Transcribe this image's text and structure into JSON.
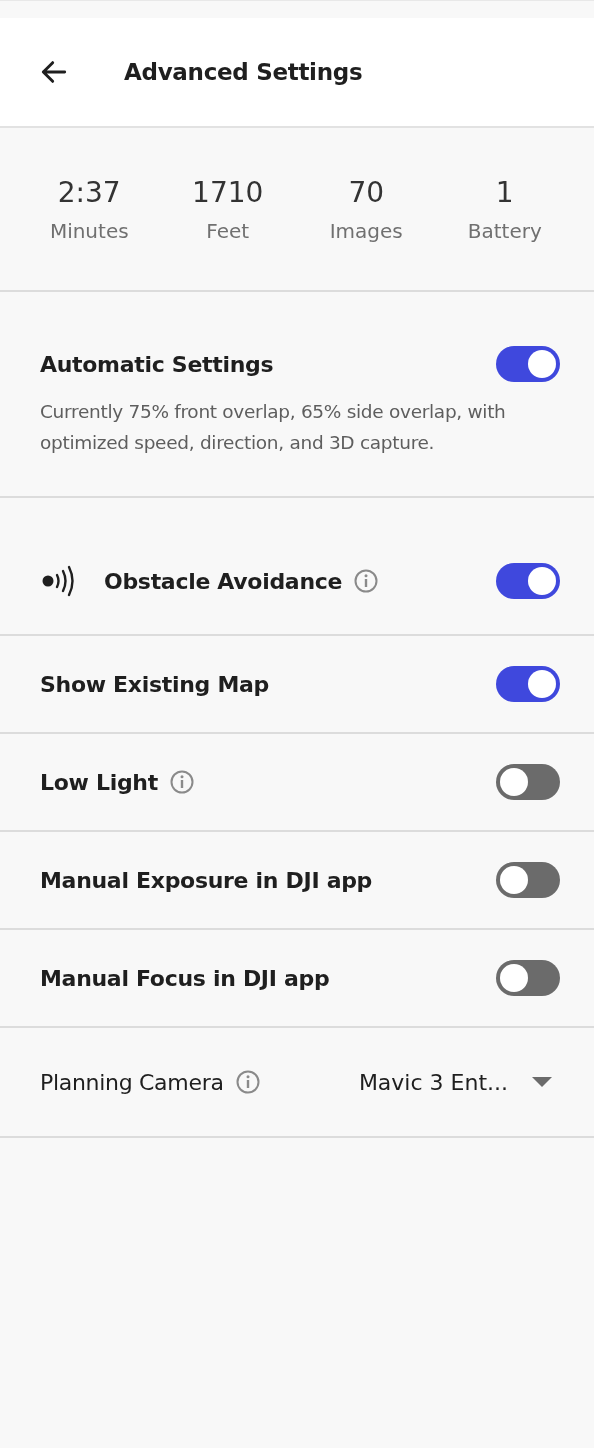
{
  "header": {
    "title": "Advanced Settings"
  },
  "stats": [
    {
      "value": "2:37",
      "label": "Minutes"
    },
    {
      "value": "1710",
      "label": "Feet"
    },
    {
      "value": "70",
      "label": "Images"
    },
    {
      "value": "1",
      "label": "Battery"
    }
  ],
  "automatic": {
    "title": "Automatic Settings",
    "on": true,
    "description": "Currently 75% front overlap, 65% side overlap, with optimized speed, direction, and 3D capture."
  },
  "settings": [
    {
      "kind": "icon_toggle",
      "label": "Obstacle Avoidance",
      "info": true,
      "on": true
    },
    {
      "kind": "toggle",
      "label": "Show Existing Map",
      "info": false,
      "on": true
    },
    {
      "kind": "toggle",
      "label": "Low Light",
      "info": true,
      "on": false
    },
    {
      "kind": "toggle",
      "label": "Manual Exposure in DJI app",
      "info": false,
      "on": false
    },
    {
      "kind": "toggle",
      "label": "Manual Focus in DJI app",
      "info": false,
      "on": false
    },
    {
      "kind": "select",
      "label": "Planning Camera",
      "info": true,
      "value": "Mavic 3 Ent..."
    }
  ]
}
